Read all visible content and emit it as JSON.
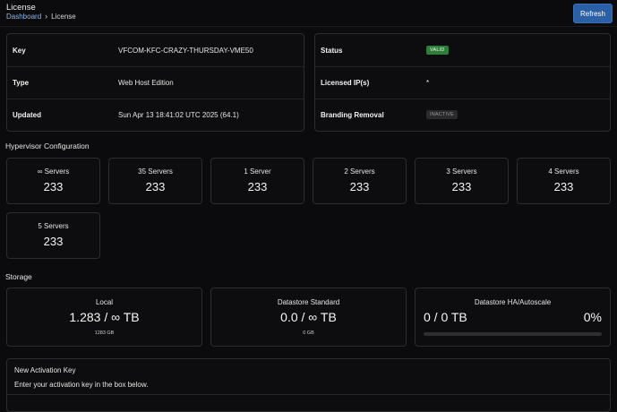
{
  "header": {
    "title": "License",
    "breadcrumb": {
      "parent": "Dashboard",
      "separator": "›",
      "current": "License"
    },
    "refresh_label": "Refresh"
  },
  "license": {
    "rows": [
      {
        "key": "Key",
        "value": "VFCOM-KFC-CRAZY-THURSDAY-VME50"
      },
      {
        "key": "Type",
        "value": "Web Host Edition"
      },
      {
        "key": "Updated",
        "value": "Sun Apr 13 18:41:02 UTC 2025 (64.1)"
      }
    ]
  },
  "status": {
    "rows": [
      {
        "key": "Status",
        "value": "VALID",
        "kind": "badge-valid"
      },
      {
        "key": "Licensed IP(s)",
        "value": "*",
        "kind": "text"
      },
      {
        "key": "Branding Removal",
        "value": "INACTIVE",
        "kind": "badge-inactive"
      }
    ]
  },
  "hypervisor": {
    "title": "Hypervisor Configuration",
    "items": [
      {
        "label": "∞ Servers",
        "value": "233"
      },
      {
        "label": "35 Servers",
        "value": "233"
      },
      {
        "label": "1 Server",
        "value": "233"
      },
      {
        "label": "2 Servers",
        "value": "233"
      },
      {
        "label": "3 Servers",
        "value": "233"
      },
      {
        "label": "4 Servers",
        "value": "233"
      },
      {
        "label": "5 Servers",
        "value": "233"
      }
    ]
  },
  "storage": {
    "title": "Storage",
    "local": {
      "title": "Local",
      "value": "1.283 / ∞ TB",
      "sub": "1283 GB"
    },
    "datastore_standard": {
      "title": "Datastore Standard",
      "value": "0.0 / ∞ TB",
      "sub": "0 GB"
    },
    "datastore_ha": {
      "title": "Datastore HA/Autoscale",
      "value": "0 / 0 TB",
      "percent": "0%",
      "progress_fraction": 0
    }
  },
  "activation": {
    "title": "New Activation Key",
    "description": "Enter your activation key in the box below."
  },
  "colors": {
    "background": "#0b0b0d",
    "card_border": "#2c2c30",
    "accent": "#2b5fa6",
    "valid": "#2f7d3c",
    "inactive": "#2a2a2e",
    "link": "#8fb6e8"
  }
}
